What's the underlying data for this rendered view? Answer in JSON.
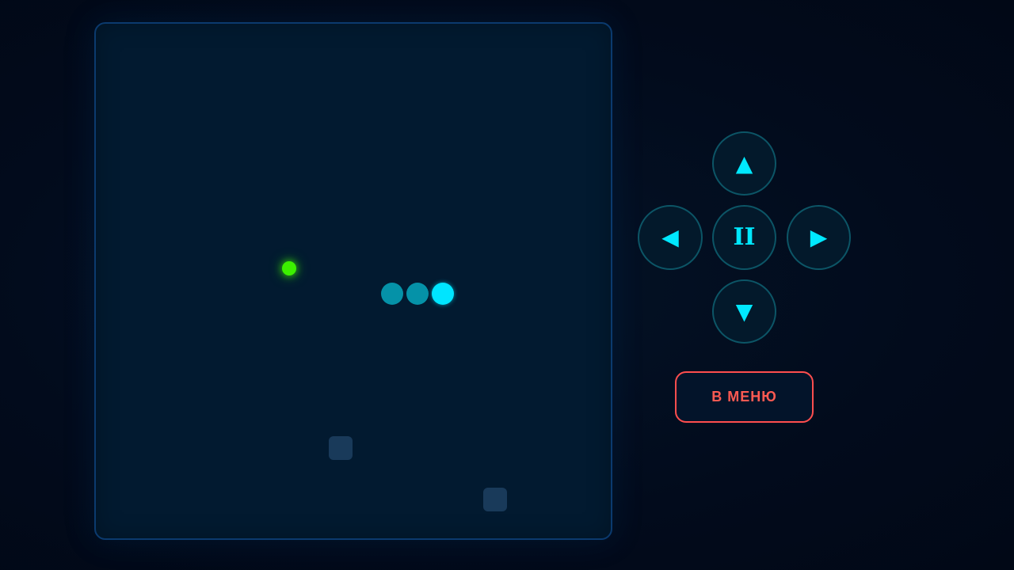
{
  "colors": {
    "background": "#020b1c",
    "board": "#021a30",
    "board_border": "#0b3a6e",
    "snake_body": "#0592a8",
    "snake_head": "#00e5ff",
    "food": "#3cf000",
    "obstacle": "#193a5a",
    "control_accent": "#00e8ff",
    "menu_accent": "#ff5a52"
  },
  "controls": {
    "up": {
      "glyph": "▲",
      "icon": "arrow-up-icon"
    },
    "left": {
      "glyph": "◀",
      "icon": "arrow-left-icon"
    },
    "pause": {
      "glyph": "II",
      "icon": "pause-icon"
    },
    "right": {
      "glyph": "▶",
      "icon": "arrow-right-icon"
    },
    "down": {
      "glyph": "▼",
      "icon": "arrow-down-icon"
    }
  },
  "menu_button": {
    "label": "В МЕНЮ"
  }
}
